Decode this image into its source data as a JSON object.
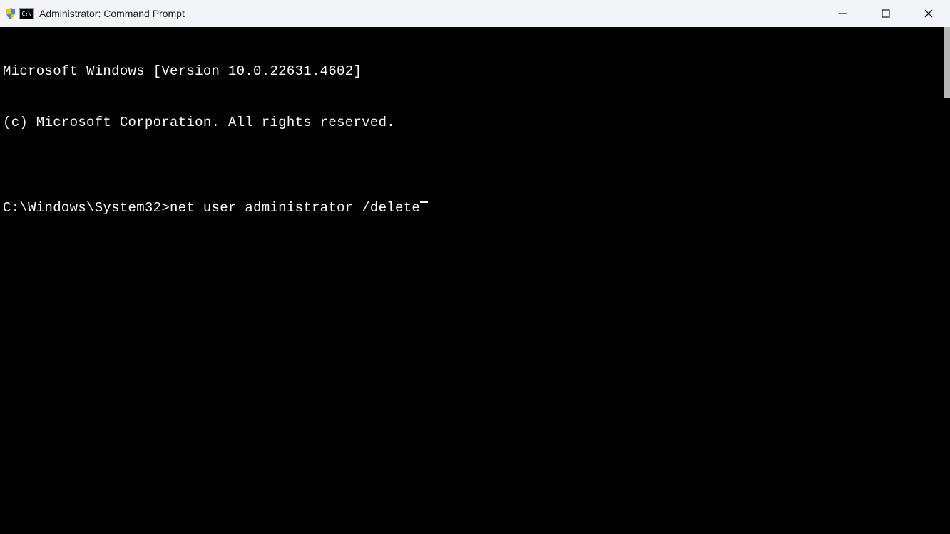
{
  "window": {
    "title": "Administrator: Command Prompt"
  },
  "terminal": {
    "line1": "Microsoft Windows [Version 10.0.22631.4602]",
    "line2": "(c) Microsoft Corporation. All rights reserved.",
    "blank": "",
    "prompt": "C:\\Windows\\System32>",
    "command": "net user administrator /delete"
  }
}
